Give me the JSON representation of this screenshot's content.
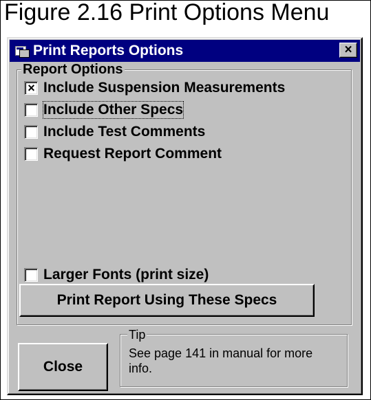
{
  "figure": {
    "caption": "Figure 2.16  Print Options Menu"
  },
  "window": {
    "title": "Print Reports Options",
    "app_icon": "app-window-icon",
    "close_glyph": "×",
    "close_icon": "close-icon"
  },
  "report_options": {
    "label": "Report Options",
    "items": [
      {
        "label": "Include Suspension Measurements",
        "checked": true,
        "check_glyph": "×"
      },
      {
        "label": "Include Other Specs",
        "checked": false,
        "focused": true
      },
      {
        "label": "Include Test Comments",
        "checked": false
      },
      {
        "label": "Request Report Comment",
        "checked": false
      }
    ],
    "larger_fonts": {
      "label": "Larger Fonts (print size)",
      "checked": false
    },
    "print_button": "Print Report Using These Specs"
  },
  "close_button": "Close",
  "tip": {
    "label": "Tip",
    "text": "See page 141 in manual for more info."
  },
  "colors": {
    "title_bar": "#000080",
    "dialog_face": "#c0c0c0"
  }
}
